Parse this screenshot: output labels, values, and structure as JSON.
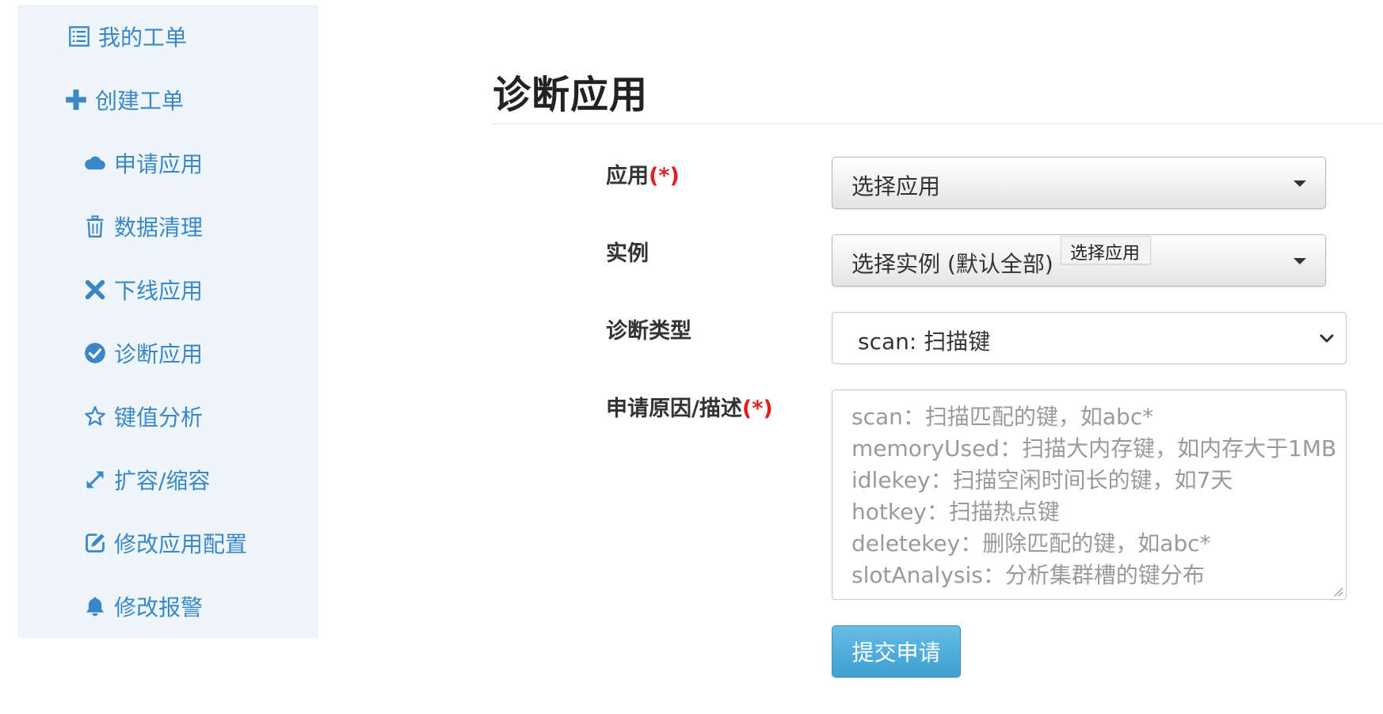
{
  "sidebar": {
    "items": [
      {
        "label": "我的工单",
        "icon": "list-alt-icon"
      },
      {
        "label": "创建工单",
        "icon": "plus-icon"
      },
      {
        "label": "申请应用",
        "icon": "cloud-icon"
      },
      {
        "label": "数据清理",
        "icon": "trash-icon"
      },
      {
        "label": "下线应用",
        "icon": "close-icon"
      },
      {
        "label": "诊断应用",
        "icon": "check-circle-icon"
      },
      {
        "label": "键值分析",
        "icon": "star-outline-icon"
      },
      {
        "label": "扩容/缩容",
        "icon": "resize-icon"
      },
      {
        "label": "修改应用配置",
        "icon": "edit-icon"
      },
      {
        "label": "修改报警",
        "icon": "bell-icon"
      }
    ]
  },
  "page": {
    "title": "诊断应用"
  },
  "form": {
    "required_mark": "(*)",
    "app": {
      "label": "应用",
      "value": "选择应用"
    },
    "instance": {
      "label": "实例",
      "value": "选择实例 (默认全部)",
      "tooltip": "选择应用"
    },
    "diag_type": {
      "label": "诊断类型",
      "value": "scan: 扫描键"
    },
    "reason": {
      "label": "申请原因/描述",
      "placeholder_lines": [
        "scan：扫描匹配的键，如abc*",
        "memoryUsed：扫描大内存键，如内存大于1MB",
        "idlekey：扫描空闲时间长的键，如7天",
        "hotkey：扫描热点键",
        "deletekey：删除匹配的键，如abc*",
        "slotAnalysis：分析集群槽的键分布"
      ]
    },
    "submit_label": "提交申请"
  },
  "colors": {
    "sidebar_bg": "#eef6fc",
    "link": "#3a87c8",
    "required": "#e02020",
    "submit_bg": "#4aaee0"
  }
}
